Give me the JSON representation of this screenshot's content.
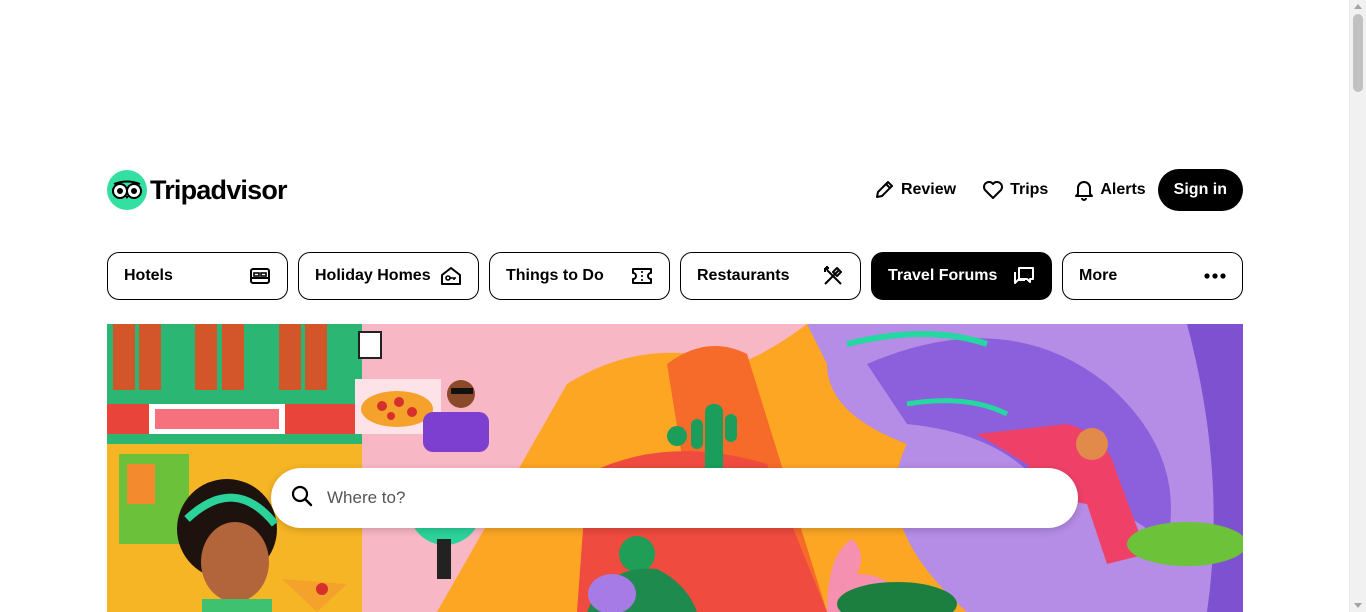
{
  "brand": {
    "name": "Tripadvisor",
    "logo_icon": "owl-eyes-icon",
    "accent": "#34e0a1"
  },
  "header": {
    "review_label": "Review",
    "trips_label": "Trips",
    "alerts_label": "Alerts",
    "signin_label": "Sign in"
  },
  "categories": [
    {
      "label": "Hotels",
      "icon": "bed-icon",
      "active": false
    },
    {
      "label": "Holiday Homes",
      "icon": "house-key-icon",
      "active": false
    },
    {
      "label": "Things to Do",
      "icon": "ticket-icon",
      "active": false
    },
    {
      "label": "Restaurants",
      "icon": "fork-knife-icon",
      "active": false
    },
    {
      "label": "Travel Forums",
      "icon": "chat-bubbles-icon",
      "active": true
    },
    {
      "label": "More",
      "icon": "more-dots-icon",
      "active": false
    }
  ],
  "search": {
    "placeholder": "Where to?",
    "value": "",
    "icon": "search-icon"
  },
  "colors": {
    "active_tab_bg": "#000000",
    "text": "#000000"
  }
}
